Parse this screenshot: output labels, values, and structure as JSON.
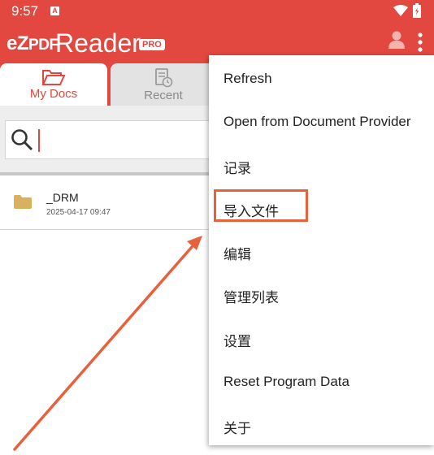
{
  "status_bar": {
    "time": "9:57",
    "notif_letter": "A"
  },
  "app": {
    "logo": "eZ",
    "logo_pdf": "PDF",
    "name": "Reader",
    "badge": "PRO"
  },
  "tabs": [
    {
      "label": "My Docs",
      "icon": "folder-open-icon",
      "active": true
    },
    {
      "label": "Recent",
      "icon": "recent-doc-icon",
      "active": false
    }
  ],
  "search": {
    "value": ""
  },
  "files": [
    {
      "name": "_DRM",
      "date": "2025-04-17 09:47",
      "icon": "folder-icon"
    }
  ],
  "menu": {
    "items": [
      "Refresh",
      "Open from Document Provider",
      "记录",
      "导入文件",
      "编辑",
      "管理列表",
      "设置",
      "Reset Program Data",
      "关于"
    ],
    "highlighted": "导入文件"
  },
  "colors": {
    "accent": "#e2483f",
    "annotation": "#e8613d"
  }
}
